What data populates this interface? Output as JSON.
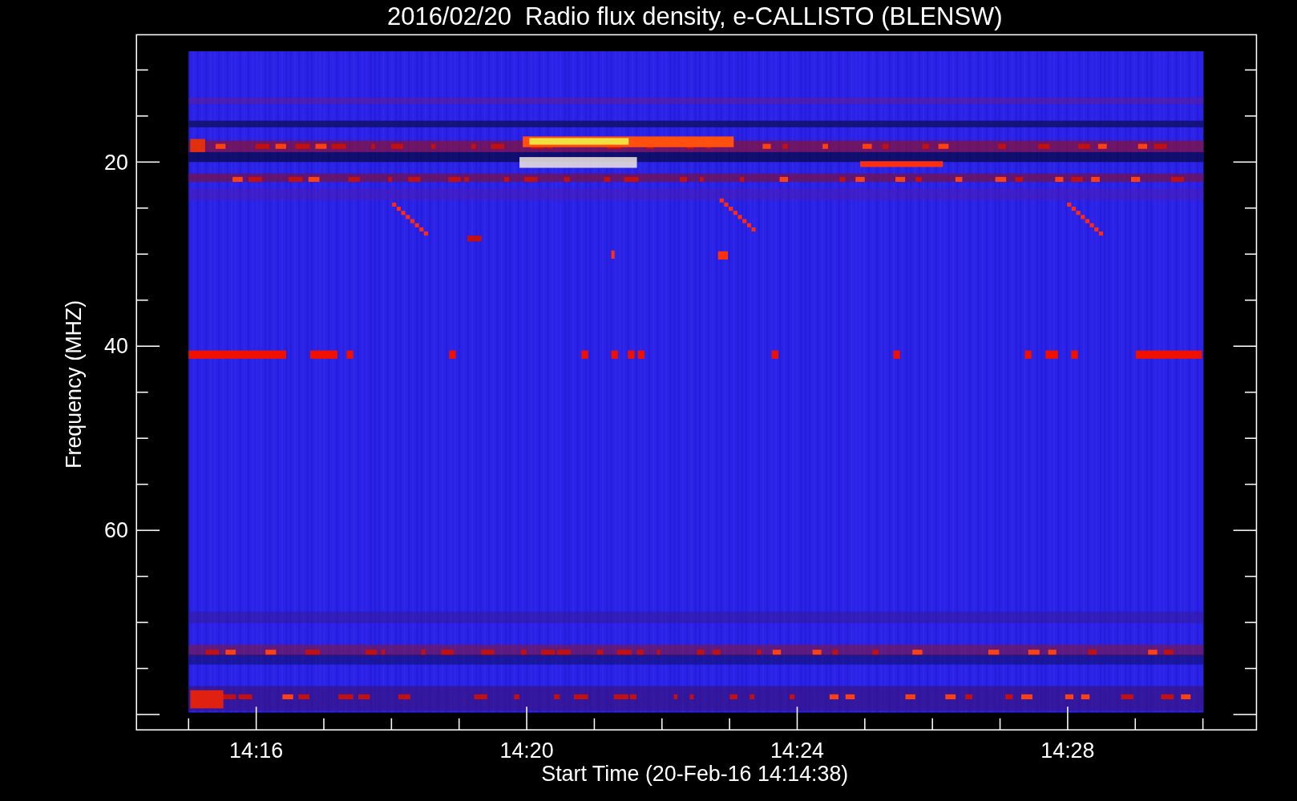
{
  "title": "2016/02/20  Radio flux density, e-CALLISTO (BLENSW)",
  "y_axis": {
    "label": "Frequency (MHZ)",
    "ticks": [
      "20",
      "40",
      "60"
    ]
  },
  "x_axis": {
    "label": "Start Time (20-Feb-16 14:14:38)",
    "ticks": [
      "14:16",
      "14:20",
      "14:24",
      "14:28"
    ]
  },
  "plot": {
    "kind": "spectrogram"
  }
}
